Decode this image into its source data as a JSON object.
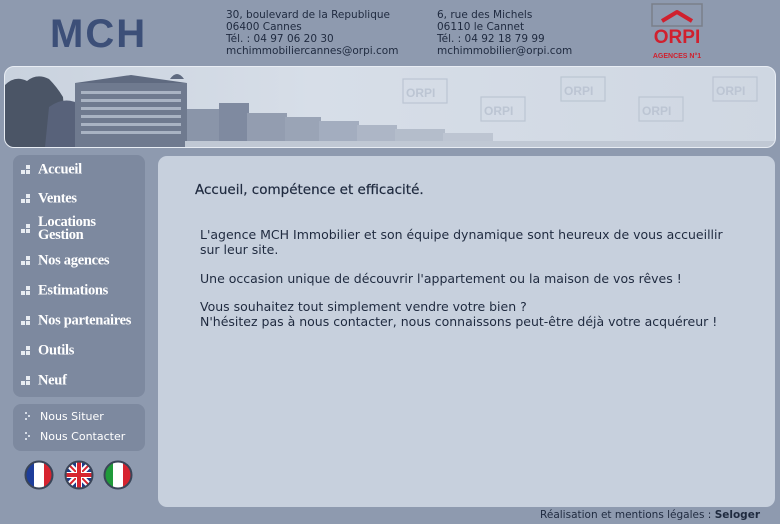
{
  "header": {
    "logo_text": "MCH",
    "agency1": {
      "street": "30, boulevard de la Republique",
      "city": "06400 Cannes",
      "phone": "Tél. : 04 97 06 20 30",
      "email": "mchimmobiliercannes@orpi.com"
    },
    "agency2": {
      "street": "6, rue des Michels",
      "city": "06110 le Cannet",
      "phone": "Tél. : 04 92 18 79 99",
      "email": "mchimmobilier@orpi.com"
    },
    "partner_logo": {
      "name": "ORPI",
      "tagline": "AGENCES N°1"
    }
  },
  "banner": {
    "watermark": "ORPI"
  },
  "nav": {
    "items": [
      {
        "label": "Accueil"
      },
      {
        "label": "Ventes"
      },
      {
        "label": "Locations Gestion"
      },
      {
        "label": "Nos agences"
      },
      {
        "label": "Estimations"
      },
      {
        "label": "Nos partenaires"
      },
      {
        "label": "Outils"
      },
      {
        "label": "Neuf"
      }
    ],
    "secondary": [
      {
        "label": "Nous Situer"
      },
      {
        "label": "Nous Contacter"
      }
    ]
  },
  "languages": [
    "french-flag-icon",
    "uk-flag-icon",
    "italian-flag-icon"
  ],
  "main": {
    "title": "Accueil, compétence et efficacité.",
    "paragraph1": "L'agence MCH Immobilier et son équipe dynamique sont heureux de vous accueillir sur leur site.",
    "paragraph2": "Une occasion unique de découvrir l'appartement ou la maison de vos rêves !",
    "paragraph3_line1": "Vous souhaitez tout simplement vendre votre bien ?",
    "paragraph3_line2": "N'hésitez pas à nous contacter, nous connaissons peut-être déjà votre acquéreur !"
  },
  "footer": {
    "text": "Réalisation et mentions légales :",
    "link": "Seloger"
  },
  "colors": {
    "background": "#8e9aaf",
    "content_panel": "#c7d0dd",
    "sidebar": "#7d899f",
    "logo_blue": "#3c4f78",
    "orpi_red": "#d0202e"
  }
}
